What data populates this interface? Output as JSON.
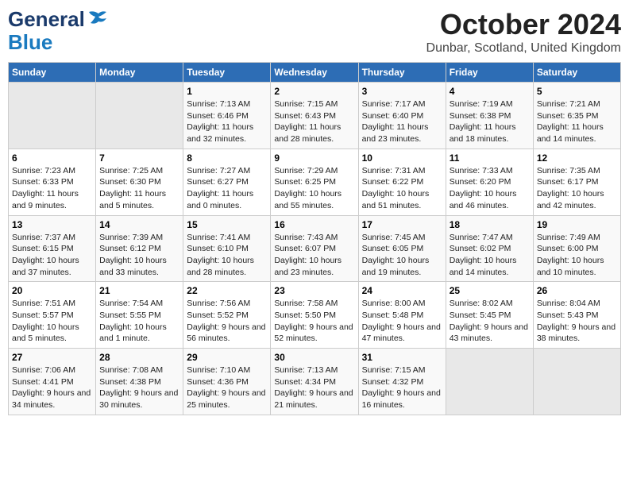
{
  "header": {
    "logo_general": "General",
    "logo_blue": "Blue",
    "title": "October 2024",
    "subtitle": "Dunbar, Scotland, United Kingdom"
  },
  "weekdays": [
    "Sunday",
    "Monday",
    "Tuesday",
    "Wednesday",
    "Thursday",
    "Friday",
    "Saturday"
  ],
  "weeks": [
    [
      {
        "day": "",
        "empty": true
      },
      {
        "day": "",
        "empty": true
      },
      {
        "day": "1",
        "sunrise": "Sunrise: 7:13 AM",
        "sunset": "Sunset: 6:46 PM",
        "daylight": "Daylight: 11 hours and 32 minutes."
      },
      {
        "day": "2",
        "sunrise": "Sunrise: 7:15 AM",
        "sunset": "Sunset: 6:43 PM",
        "daylight": "Daylight: 11 hours and 28 minutes."
      },
      {
        "day": "3",
        "sunrise": "Sunrise: 7:17 AM",
        "sunset": "Sunset: 6:40 PM",
        "daylight": "Daylight: 11 hours and 23 minutes."
      },
      {
        "day": "4",
        "sunrise": "Sunrise: 7:19 AM",
        "sunset": "Sunset: 6:38 PM",
        "daylight": "Daylight: 11 hours and 18 minutes."
      },
      {
        "day": "5",
        "sunrise": "Sunrise: 7:21 AM",
        "sunset": "Sunset: 6:35 PM",
        "daylight": "Daylight: 11 hours and 14 minutes."
      }
    ],
    [
      {
        "day": "6",
        "sunrise": "Sunrise: 7:23 AM",
        "sunset": "Sunset: 6:33 PM",
        "daylight": "Daylight: 11 hours and 9 minutes."
      },
      {
        "day": "7",
        "sunrise": "Sunrise: 7:25 AM",
        "sunset": "Sunset: 6:30 PM",
        "daylight": "Daylight: 11 hours and 5 minutes."
      },
      {
        "day": "8",
        "sunrise": "Sunrise: 7:27 AM",
        "sunset": "Sunset: 6:27 PM",
        "daylight": "Daylight: 11 hours and 0 minutes."
      },
      {
        "day": "9",
        "sunrise": "Sunrise: 7:29 AM",
        "sunset": "Sunset: 6:25 PM",
        "daylight": "Daylight: 10 hours and 55 minutes."
      },
      {
        "day": "10",
        "sunrise": "Sunrise: 7:31 AM",
        "sunset": "Sunset: 6:22 PM",
        "daylight": "Daylight: 10 hours and 51 minutes."
      },
      {
        "day": "11",
        "sunrise": "Sunrise: 7:33 AM",
        "sunset": "Sunset: 6:20 PM",
        "daylight": "Daylight: 10 hours and 46 minutes."
      },
      {
        "day": "12",
        "sunrise": "Sunrise: 7:35 AM",
        "sunset": "Sunset: 6:17 PM",
        "daylight": "Daylight: 10 hours and 42 minutes."
      }
    ],
    [
      {
        "day": "13",
        "sunrise": "Sunrise: 7:37 AM",
        "sunset": "Sunset: 6:15 PM",
        "daylight": "Daylight: 10 hours and 37 minutes."
      },
      {
        "day": "14",
        "sunrise": "Sunrise: 7:39 AM",
        "sunset": "Sunset: 6:12 PM",
        "daylight": "Daylight: 10 hours and 33 minutes."
      },
      {
        "day": "15",
        "sunrise": "Sunrise: 7:41 AM",
        "sunset": "Sunset: 6:10 PM",
        "daylight": "Daylight: 10 hours and 28 minutes."
      },
      {
        "day": "16",
        "sunrise": "Sunrise: 7:43 AM",
        "sunset": "Sunset: 6:07 PM",
        "daylight": "Daylight: 10 hours and 23 minutes."
      },
      {
        "day": "17",
        "sunrise": "Sunrise: 7:45 AM",
        "sunset": "Sunset: 6:05 PM",
        "daylight": "Daylight: 10 hours and 19 minutes."
      },
      {
        "day": "18",
        "sunrise": "Sunrise: 7:47 AM",
        "sunset": "Sunset: 6:02 PM",
        "daylight": "Daylight: 10 hours and 14 minutes."
      },
      {
        "day": "19",
        "sunrise": "Sunrise: 7:49 AM",
        "sunset": "Sunset: 6:00 PM",
        "daylight": "Daylight: 10 hours and 10 minutes."
      }
    ],
    [
      {
        "day": "20",
        "sunrise": "Sunrise: 7:51 AM",
        "sunset": "Sunset: 5:57 PM",
        "daylight": "Daylight: 10 hours and 5 minutes."
      },
      {
        "day": "21",
        "sunrise": "Sunrise: 7:54 AM",
        "sunset": "Sunset: 5:55 PM",
        "daylight": "Daylight: 10 hours and 1 minute."
      },
      {
        "day": "22",
        "sunrise": "Sunrise: 7:56 AM",
        "sunset": "Sunset: 5:52 PM",
        "daylight": "Daylight: 9 hours and 56 minutes."
      },
      {
        "day": "23",
        "sunrise": "Sunrise: 7:58 AM",
        "sunset": "Sunset: 5:50 PM",
        "daylight": "Daylight: 9 hours and 52 minutes."
      },
      {
        "day": "24",
        "sunrise": "Sunrise: 8:00 AM",
        "sunset": "Sunset: 5:48 PM",
        "daylight": "Daylight: 9 hours and 47 minutes."
      },
      {
        "day": "25",
        "sunrise": "Sunrise: 8:02 AM",
        "sunset": "Sunset: 5:45 PM",
        "daylight": "Daylight: 9 hours and 43 minutes."
      },
      {
        "day": "26",
        "sunrise": "Sunrise: 8:04 AM",
        "sunset": "Sunset: 5:43 PM",
        "daylight": "Daylight: 9 hours and 38 minutes."
      }
    ],
    [
      {
        "day": "27",
        "sunrise": "Sunrise: 7:06 AM",
        "sunset": "Sunset: 4:41 PM",
        "daylight": "Daylight: 9 hours and 34 minutes."
      },
      {
        "day": "28",
        "sunrise": "Sunrise: 7:08 AM",
        "sunset": "Sunset: 4:38 PM",
        "daylight": "Daylight: 9 hours and 30 minutes."
      },
      {
        "day": "29",
        "sunrise": "Sunrise: 7:10 AM",
        "sunset": "Sunset: 4:36 PM",
        "daylight": "Daylight: 9 hours and 25 minutes."
      },
      {
        "day": "30",
        "sunrise": "Sunrise: 7:13 AM",
        "sunset": "Sunset: 4:34 PM",
        "daylight": "Daylight: 9 hours and 21 minutes."
      },
      {
        "day": "31",
        "sunrise": "Sunrise: 7:15 AM",
        "sunset": "Sunset: 4:32 PM",
        "daylight": "Daylight: 9 hours and 16 minutes."
      },
      {
        "day": "",
        "empty": true
      },
      {
        "day": "",
        "empty": true
      }
    ]
  ]
}
